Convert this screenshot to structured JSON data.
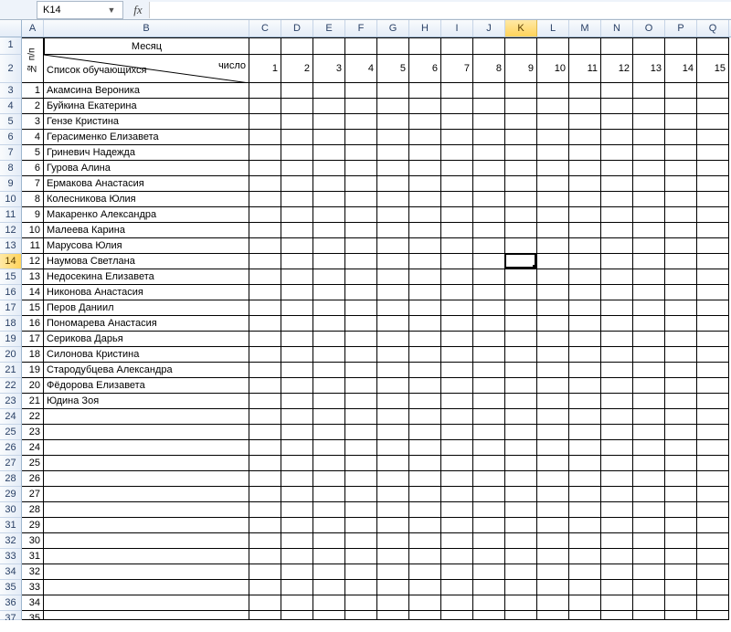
{
  "formula_bar": {
    "cell_ref": "K14",
    "fx_label": "fx",
    "formula_value": ""
  },
  "columns": [
    "A",
    "B",
    "C",
    "D",
    "E",
    "F",
    "G",
    "H",
    "I",
    "J",
    "K",
    "L",
    "M",
    "N",
    "O",
    "P",
    "Q"
  ],
  "selected_column": "K",
  "selected_row": 14,
  "header": {
    "month_label": "Месяц",
    "vert_label": "№ п/п",
    "diag_top": "Список обучающихся",
    "diag_bottom": "число",
    "day_numbers": [
      1,
      2,
      3,
      4,
      5,
      6,
      7,
      8,
      9,
      10,
      11,
      12,
      13,
      14,
      15
    ]
  },
  "students": [
    {
      "num": 1,
      "name": "Акамсина Вероника"
    },
    {
      "num": 2,
      "name": "Буйкина Екатерина"
    },
    {
      "num": 3,
      "name": "Гензе Кристина"
    },
    {
      "num": 4,
      "name": "Герасименко Елизавета"
    },
    {
      "num": 5,
      "name": "Гриневич Надежда"
    },
    {
      "num": 6,
      "name": "Гурова Алина"
    },
    {
      "num": 7,
      "name": "Ермакова Анастасия"
    },
    {
      "num": 8,
      "name": "Колесникова Юлия"
    },
    {
      "num": 9,
      "name": "Макаренко Александра"
    },
    {
      "num": 10,
      "name": "Малеева Карина"
    },
    {
      "num": 11,
      "name": "Марусова Юлия"
    },
    {
      "num": 12,
      "name": "Наумова Светлана"
    },
    {
      "num": 13,
      "name": "Недосекина Елизавета"
    },
    {
      "num": 14,
      "name": "Никонова Анастасия"
    },
    {
      "num": 15,
      "name": "Перов Даниил"
    },
    {
      "num": 16,
      "name": "Пономарева Анастасия"
    },
    {
      "num": 17,
      "name": "Серикова Дарья"
    },
    {
      "num": 18,
      "name": "Силонова Кристина"
    },
    {
      "num": 19,
      "name": "Стародубцева Александра"
    },
    {
      "num": 20,
      "name": "Фёдорова Елизавета"
    },
    {
      "num": 21,
      "name": "Юдина Зоя"
    }
  ],
  "extra_numbered_rows": [
    22,
    23,
    24,
    25,
    26,
    27,
    28,
    29,
    30,
    31,
    32,
    33,
    34
  ],
  "trailing_row": 35,
  "total_rows": 37
}
